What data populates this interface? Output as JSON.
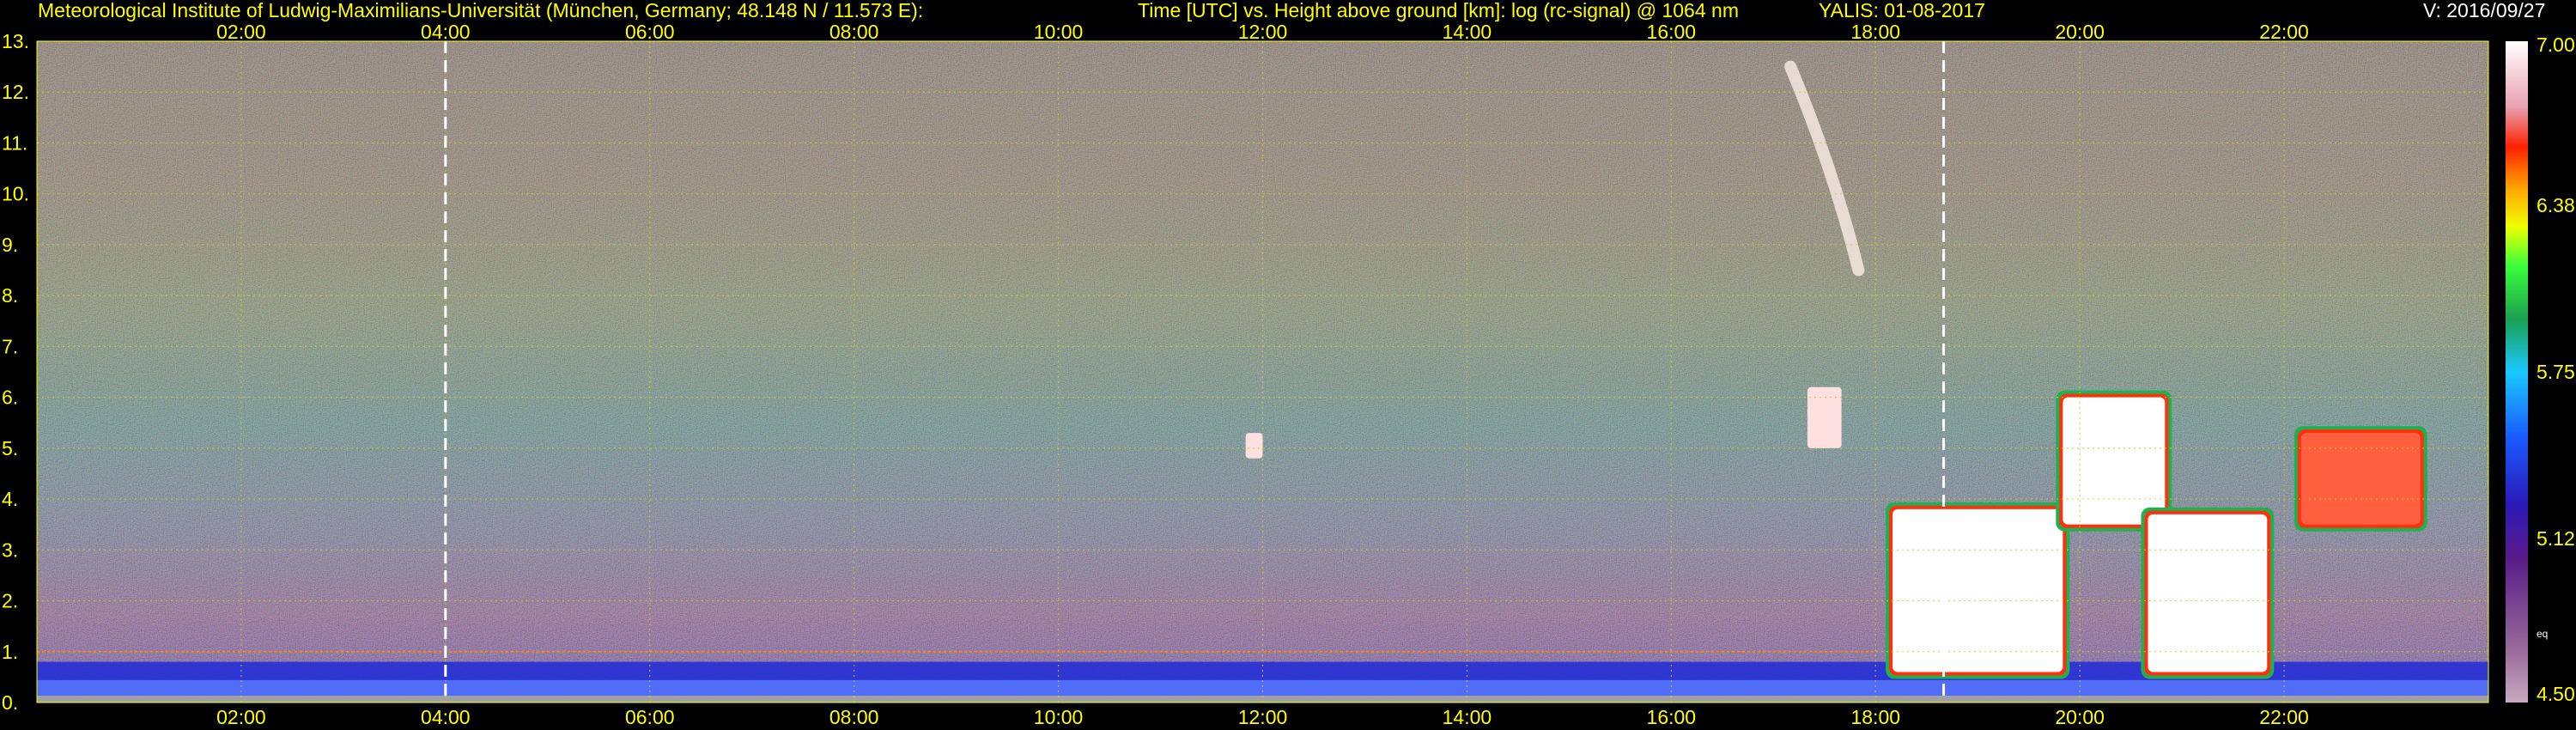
{
  "header": {
    "institute": "Meteorological Institute of Ludwig-Maximilians-Universität (München, Germany; 48.148 N / 11.573 E):",
    "description": "Time [UTC] vs. Height above ground [km]: log (rc-signal) @ 1064 nm",
    "instrument_date": "YALIS: 01-08-2017",
    "version": "V: 2016/09/27"
  },
  "colorbar": {
    "ticks": [
      {
        "value": 7.0,
        "label": "7.00"
      },
      {
        "value": 6.38,
        "label": "6.38"
      },
      {
        "value": 5.75,
        "label": "5.75"
      },
      {
        "value": 5.12,
        "label": "5.12"
      },
      {
        "value": 4.5,
        "label": "4.50"
      }
    ],
    "small_label": "eq",
    "min": 4.5,
    "max": 7.0
  },
  "colors": {
    "title_text": "#ffff00",
    "version_text": "#ffffff",
    "tick_text": "#ffff00",
    "grid": "#cccc33",
    "boundary_line": "#ff8c00",
    "marker_line": "#ffffff",
    "background": "#000000"
  },
  "chart_data": {
    "type": "heatmap",
    "title": "Time [UTC] vs. Height above ground [km]: log (rc-signal) @ 1064 nm",
    "x_unit": "UTC",
    "y_unit": "km",
    "xlim": [
      "00:00",
      "24:00"
    ],
    "ylim": [
      0,
      13
    ],
    "x_ticks": [
      "02:00",
      "04:00",
      "06:00",
      "08:00",
      "10:00",
      "12:00",
      "14:00",
      "16:00",
      "18:00",
      "20:00",
      "22:00"
    ],
    "y_ticks": [
      {
        "value": 0,
        "label": "0."
      },
      {
        "value": 1,
        "label": "1."
      },
      {
        "value": 2,
        "label": "2."
      },
      {
        "value": 3,
        "label": "3."
      },
      {
        "value": 4,
        "label": "4."
      },
      {
        "value": 5,
        "label": "5."
      },
      {
        "value": 6,
        "label": "6."
      },
      {
        "value": 7,
        "label": "7."
      },
      {
        "value": 8,
        "label": "8."
      },
      {
        "value": 9,
        "label": "9."
      },
      {
        "value": 10,
        "label": "10."
      },
      {
        "value": 11,
        "label": "11."
      },
      {
        "value": 12,
        "label": "12."
      },
      {
        "value": 13,
        "label": "13."
      }
    ],
    "grid": true,
    "vertical_markers": [
      "04:00",
      "18:40"
    ],
    "boundary_layer_line_km": 1.0,
    "features": [
      {
        "name": "boundary layer",
        "time_start": "00:00",
        "time_end": "24:00",
        "height_bottom_km": 0.0,
        "height_top_km": 0.8,
        "level": 5.8
      },
      {
        "name": "cirrus",
        "time_start": "17:10",
        "time_end": "17:50",
        "height_bottom_km": 8.5,
        "height_top_km": 12.5,
        "level": 6.9
      },
      {
        "name": "mid cloud",
        "time_start": "11:50",
        "time_end": "12:00",
        "height_bottom_km": 4.8,
        "height_top_km": 5.3,
        "level": 6.9
      },
      {
        "name": "mid cloud",
        "time_start": "17:20",
        "time_end": "17:40",
        "height_bottom_km": 5.0,
        "height_top_km": 6.2,
        "level": 6.9
      },
      {
        "name": "cloud",
        "time_start": "18:10",
        "time_end": "19:50",
        "height_bottom_km": 0.6,
        "height_top_km": 3.8,
        "level": 7.0
      },
      {
        "name": "cloud",
        "time_start": "19:50",
        "time_end": "20:50",
        "height_bottom_km": 3.5,
        "height_top_km": 6.0,
        "level": 7.0
      },
      {
        "name": "cloud",
        "time_start": "20:40",
        "time_end": "21:50",
        "height_bottom_km": 0.6,
        "height_top_km": 3.7,
        "level": 7.0
      },
      {
        "name": "cloud",
        "time_start": "22:10",
        "time_end": "23:20",
        "height_bottom_km": 3.5,
        "height_top_km": 5.3,
        "level": 6.7
      }
    ]
  }
}
